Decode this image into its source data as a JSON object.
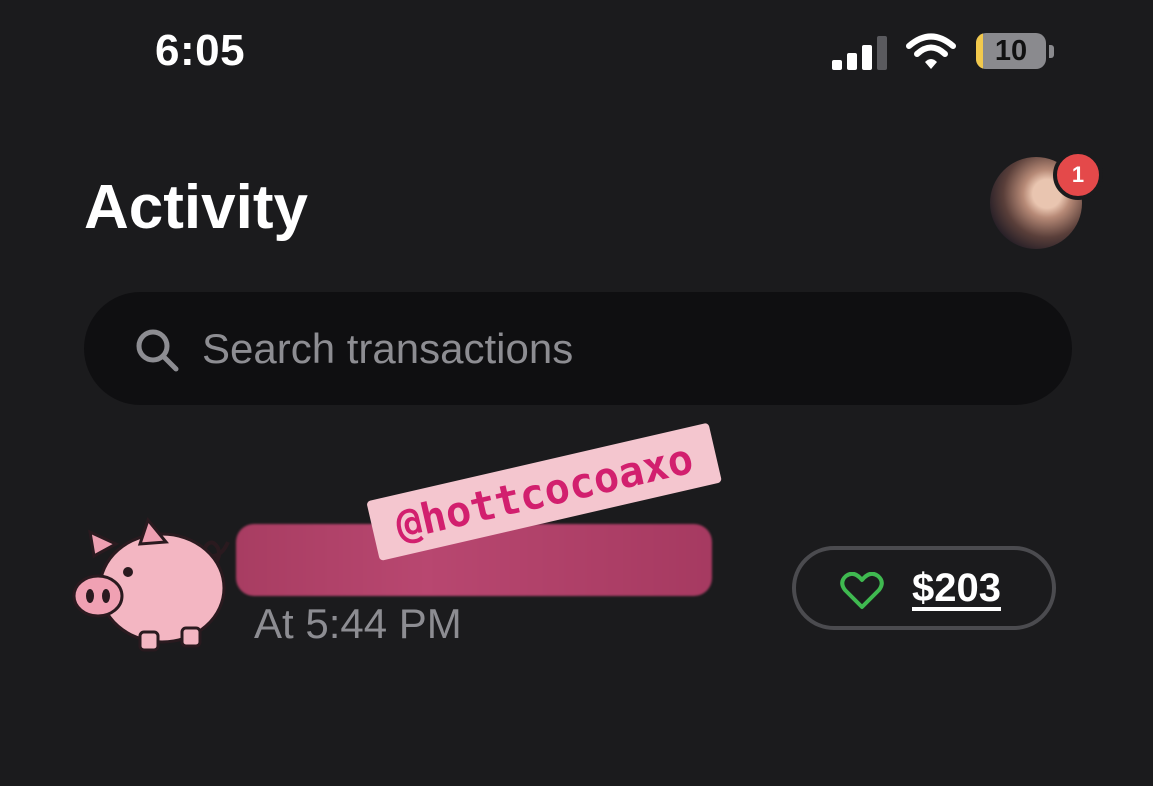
{
  "status_bar": {
    "time": "6:05",
    "battery_level": "10",
    "battery_fraction": 0.1,
    "battery_color": "#f2c94c",
    "signal_icon": "cellular-signal-icon",
    "wifi_icon": "wifi-icon"
  },
  "header": {
    "title": "Activity",
    "notification_count": "1",
    "badge_color": "#e4494a"
  },
  "search": {
    "placeholder": "Search transactions",
    "icon": "search-icon"
  },
  "transactions": [
    {
      "avatar_icon": "piggy-bank-icon",
      "name": "@hottcocoaxo",
      "time": "At 5:44 PM",
      "amount": "$203",
      "reaction_icon": "heart-icon",
      "reaction_color": "#3fb950"
    }
  ]
}
